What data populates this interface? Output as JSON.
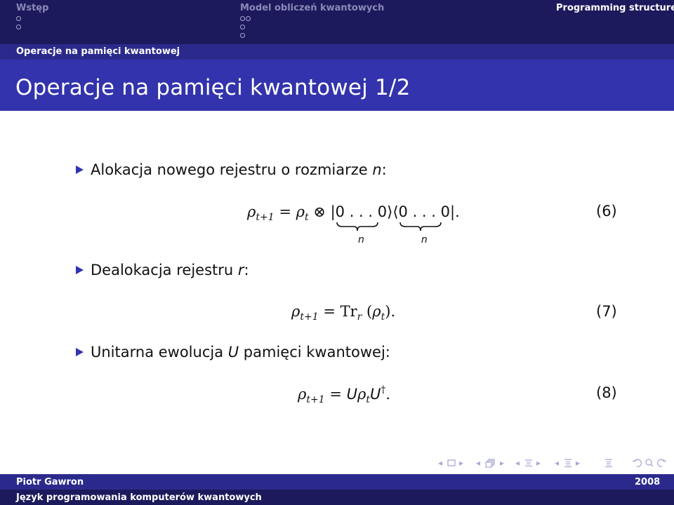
{
  "header": {
    "sections": [
      {
        "title": "Wstęp",
        "current": false,
        "dot_rows": [
          1,
          1
        ]
      },
      {
        "title": "Model obliczeń kwantowych",
        "current": false,
        "dot_rows": [
          2,
          1,
          1
        ]
      },
      {
        "title": "Programming structures",
        "current": true,
        "dot_rows": []
      }
    ],
    "subsection": "Operacje na pamięci kwantowej"
  },
  "frame": {
    "title": "Operacje na pamięci kwantowej 1/2"
  },
  "bullets": [
    {
      "text": "Alokacja nowego rejestru o rozmiarze ",
      "var": "n",
      "suffix": ":"
    },
    {
      "text": "Dealokacja rejestru ",
      "var": "r",
      "suffix": ":"
    },
    {
      "text": "Unitarna ewolucja ",
      "var": "U",
      "suffix_text": " pamięci kwantowej:"
    }
  ],
  "equations": [
    {
      "number": "(6)",
      "lhs_symbol": "ρ",
      "lhs_sub": "t+1",
      "equals": "=",
      "rho": "ρ",
      "rho_sub": "t",
      "tensor": "⊗",
      "ket_open": "|",
      "ket_content": "0 . . . 0",
      "ket_close": "⟩",
      "bra_open": "⟨",
      "bra_content": "0 . . . 0",
      "bra_close": "|",
      "brace_label": "n",
      "end": "."
    },
    {
      "number": "(7)",
      "lhs_symbol": "ρ",
      "lhs_sub": "t+1",
      "equals": "=",
      "op": "Tr",
      "op_sub": "r",
      "arg_open": "(",
      "arg": "ρ",
      "arg_sub": "t",
      "arg_close": ")",
      "end": "."
    },
    {
      "number": "(8)",
      "lhs_symbol": "ρ",
      "lhs_sub": "t+1",
      "equals": "=",
      "u": "U",
      "rho": "ρ",
      "rho_sub": "t",
      "u2": "U",
      "dagger": "†",
      "end": "."
    }
  ],
  "navigation": {
    "symbols": [
      "slide-prev",
      "slide-icon",
      "slide-next",
      "frame-prev",
      "frame-icon",
      "frame-next",
      "subsection-prev",
      "subsection-icon",
      "subsection-next",
      "section-prev",
      "section-icon",
      "section-next",
      "document-icon",
      "back-icon",
      "search-icon",
      "forward-icon"
    ],
    "left_arrow": "◂",
    "right_arrow": "▸"
  },
  "footer": {
    "author": "Piotr Gawron",
    "year": "2008",
    "talk_title": "Język programowania komputerów kwantowych"
  },
  "colors": {
    "header_dark": "#1c1a5c",
    "header_mid": "#2b2a8c",
    "frametitle": "#3333ad",
    "bullet": "#3333b3",
    "nav_inactive": "#8a89b8"
  }
}
